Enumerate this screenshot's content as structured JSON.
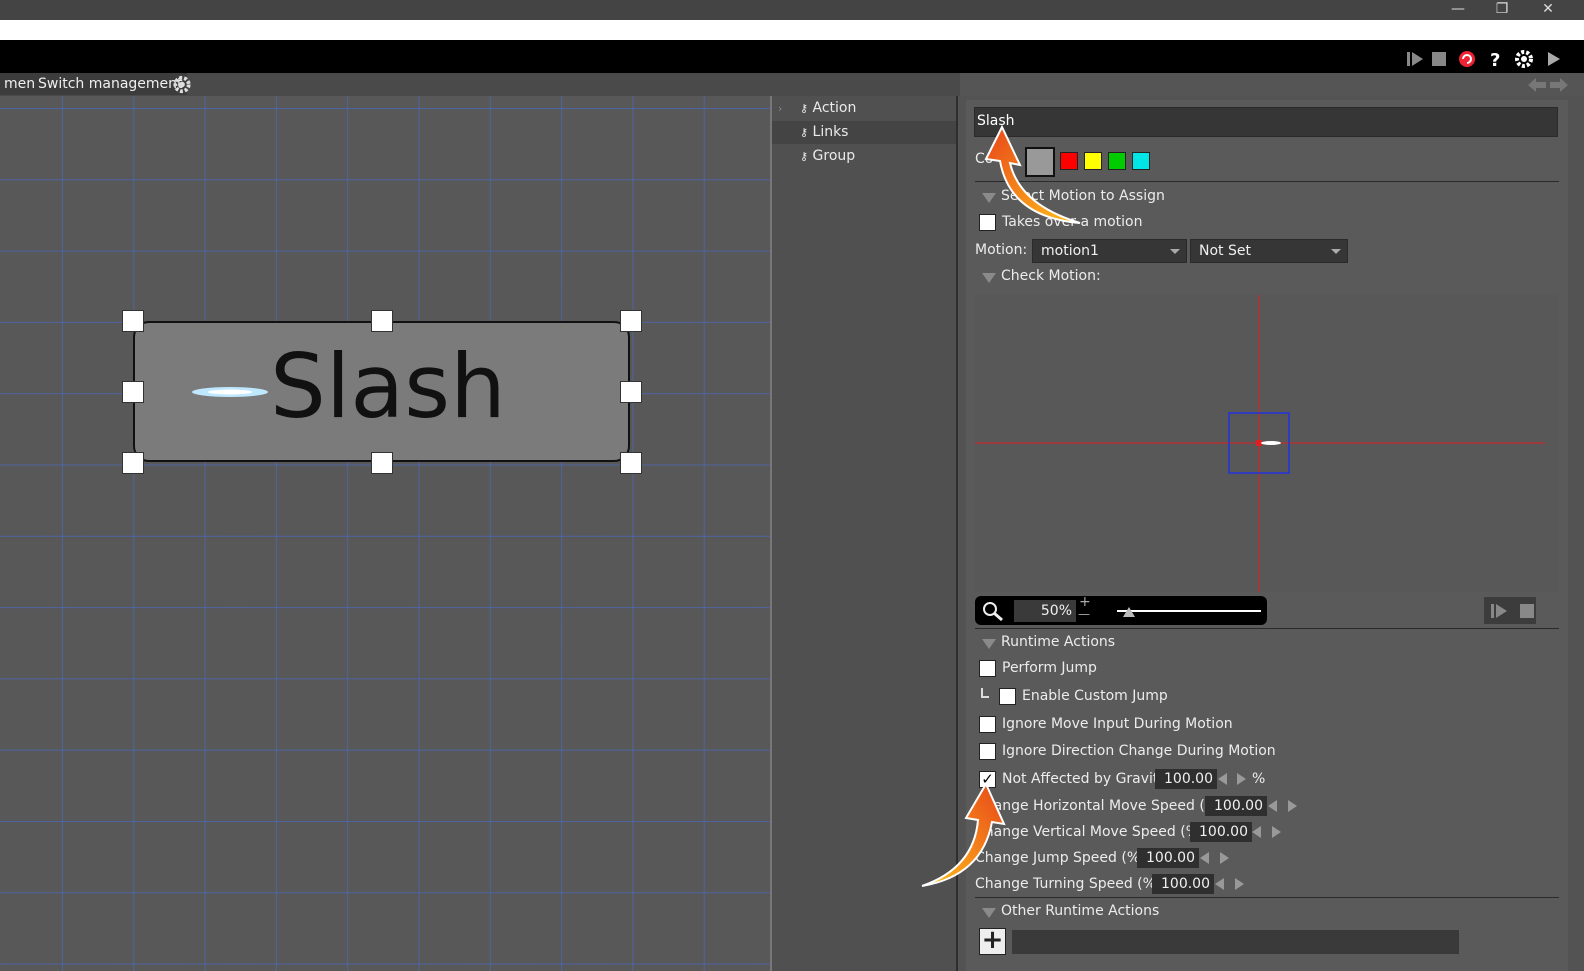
{
  "window": {
    "minimize": "—",
    "restore": "❐",
    "close": "✕"
  },
  "tabs": {
    "partial": "ment",
    "switch": "Switch management"
  },
  "canvas": {
    "node_label": "Slash"
  },
  "tree": {
    "items": [
      "Action",
      "Links",
      "Group"
    ]
  },
  "panel": {
    "name_value": "Slash",
    "color_label": "Co",
    "colors": [
      "#999999",
      "#ff0000",
      "#ffff00",
      "#00cc00",
      "#00e5e5"
    ],
    "select_motion": {
      "title": "Select Motion to Assign",
      "takes_over": "Takes over a motion",
      "motion_label": "Motion:",
      "motion_value": "motion1",
      "second_value": "Not Set"
    },
    "check_motion": {
      "title": "Check Motion:",
      "zoom": "50%",
      "zoom_plus": "+",
      "zoom_minus": "—"
    },
    "runtime": {
      "title": "Runtime Actions",
      "perform_jump": "Perform Jump",
      "enable_custom_jump": "Enable Custom Jump",
      "ignore_move": "Ignore Move Input During Motion",
      "ignore_direction": "Ignore Direction Change During Motion",
      "not_gravity": "Not Affected by Gravity",
      "gravity_value": "100.00",
      "gravity_unit": "%",
      "h_speed": "Change Horizontal Move Speed (%):",
      "h_speed_value": "100.00",
      "v_speed": "Change Vertical Move Speed (%):",
      "v_speed_value": "100.00",
      "jump_speed": "Change Jump Speed (%):",
      "jump_speed_value": "100.00",
      "turn_speed": "Change Turning Speed (%):",
      "turn_speed_value": "100.00",
      "checked": {
        "not_gravity": true
      }
    },
    "other": {
      "title": "Other Runtime Actions",
      "add": "+"
    }
  }
}
